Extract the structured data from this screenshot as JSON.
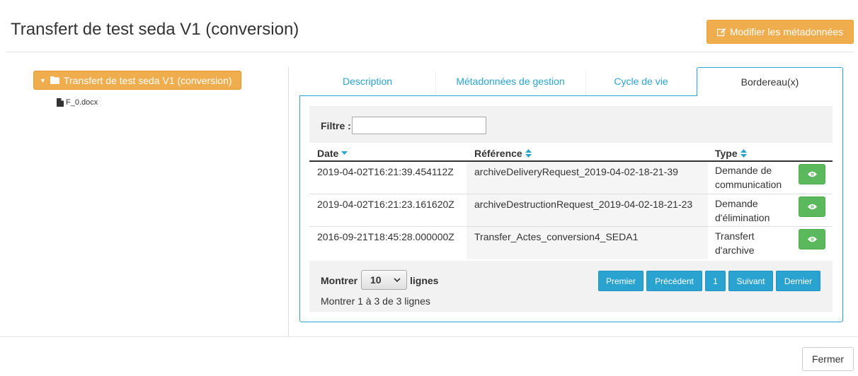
{
  "header": {
    "title": "Transfert de test seda V1 (conversion)",
    "edit_button": "Modifier les métadonnées"
  },
  "tree": {
    "root_label": "Transfert de test seda V1 (conversion)",
    "file_label": "F_0.docx"
  },
  "tabs": [
    {
      "label": "Description"
    },
    {
      "label": "Métadonnées de gestion"
    },
    {
      "label": "Cycle de vie"
    },
    {
      "label": "Bordereau(x)",
      "active": true
    }
  ],
  "filter": {
    "label": "Filtre :",
    "value": ""
  },
  "table": {
    "columns": [
      "Date",
      "Référence",
      "Type"
    ],
    "rows": [
      {
        "date": "2019-04-02T16:21:39.454112Z",
        "reference": "archiveDeliveryRequest_2019-04-02-18-21-39",
        "type_line1": "Demande de",
        "type_line2": "communication"
      },
      {
        "date": "2019-04-02T16:21:23.161620Z",
        "reference": "archiveDestructionRequest_2019-04-02-18-21-23",
        "type_line1": "Demande",
        "type_line2": "d'élimination"
      },
      {
        "date": "2016-09-21T18:45:28.000000Z",
        "reference": "Transfer_Actes_conversion4_SEDA1",
        "type_line1": "Transfert",
        "type_line2": "d'archive"
      }
    ]
  },
  "pagination": {
    "show_label": "Montrer",
    "page_size": "10",
    "lines_label": "lignes",
    "info": "Montrer 1 à 3 de 3 lignes",
    "first": "Premier",
    "previous": "Précédent",
    "current": "1",
    "next": "Suivant",
    "last": "Dernier"
  },
  "footer": {
    "close_button": "Fermer"
  },
  "colors": {
    "accent": "#2aa3d1",
    "orange": "#f0ad4e",
    "green": "#5cb85c"
  }
}
